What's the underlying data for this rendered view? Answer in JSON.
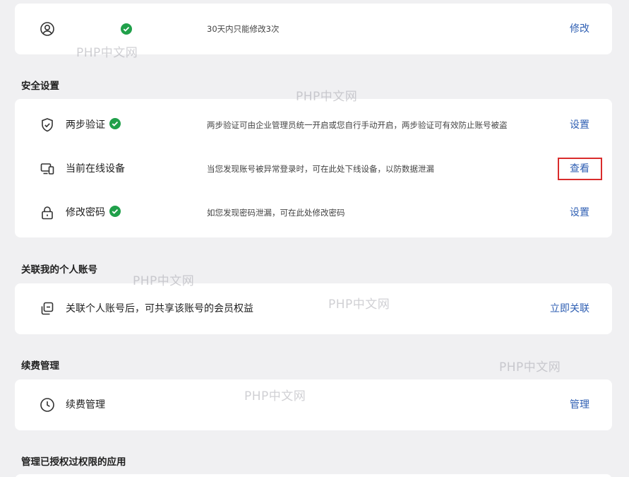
{
  "top_card": {
    "description": "30天内只能修改3次",
    "action": "修改"
  },
  "security": {
    "title": "安全设置",
    "items": [
      {
        "label": "两步验证",
        "verified": true,
        "description": "两步验证可由企业管理员统一开启或您自行手动开启，两步验证可有效防止账号被盗",
        "action": "设置"
      },
      {
        "label": "当前在线设备",
        "verified": false,
        "description": "当您发现账号被异常登录时，可在此处下线设备，以防数据泄漏",
        "action": "查看"
      },
      {
        "label": "修改密码",
        "verified": true,
        "description": "如您发现密码泄漏，可在此处修改密码",
        "action": "设置"
      }
    ]
  },
  "personal": {
    "title": "关联我的个人账号",
    "label": "关联个人账号后，可共享该账号的会员权益",
    "action": "立即关联"
  },
  "renewal": {
    "title": "续费管理",
    "label": "续费管理",
    "action": "管理"
  },
  "apps": {
    "title": "管理已授权过权限的应用"
  },
  "watermark": "PHP中文网",
  "colors": {
    "link": "#2f5fb3",
    "check": "#20a04a",
    "highlight": "#d92c2c"
  },
  "icons": [
    "user-circle-icon",
    "shield-icon",
    "devices-icon",
    "lock-icon",
    "link-accounts-icon",
    "clock-icon",
    "check-circle-icon"
  ]
}
